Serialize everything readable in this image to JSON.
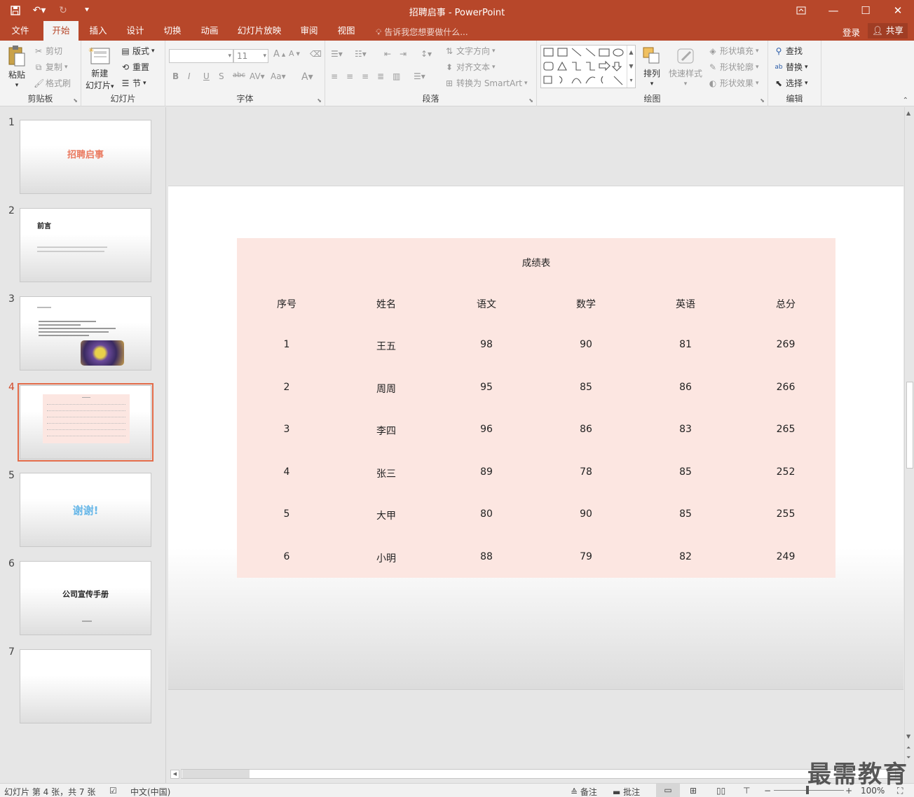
{
  "window": {
    "title": "招聘启事 - PowerPoint",
    "accent": "#b7472a"
  },
  "tabs": [
    "文件",
    "开始",
    "插入",
    "设计",
    "切换",
    "动画",
    "幻灯片放映",
    "审阅",
    "视图"
  ],
  "tell_me": "告诉我您想要做什么...",
  "account": {
    "login": "登录",
    "share": "共享"
  },
  "ribbon": {
    "clipboard": {
      "paste": "粘贴",
      "cut": "剪切",
      "copy": "复制",
      "format_painter": "格式刷",
      "label": "剪贴板"
    },
    "slides": {
      "new_slide_1": "新建",
      "new_slide_2": "幻灯片",
      "layout": "版式",
      "reset": "重置",
      "section": "节",
      "label": "幻灯片"
    },
    "font": {
      "size": "11",
      "label": "字体"
    },
    "paragraph": {
      "text_direction": "文字方向",
      "align_text": "对齐文本",
      "convert_smartart": "转换为 SmartArt",
      "label": "段落"
    },
    "drawing": {
      "arrange": "排列",
      "quick_styles": "快速样式",
      "shape_fill": "形状填充",
      "shape_outline": "形状轮廓",
      "shape_effects": "形状效果",
      "label": "绘图"
    },
    "editing": {
      "find": "查找",
      "replace": "替换",
      "select": "选择",
      "label": "编辑"
    }
  },
  "thumbnails": [
    {
      "num": "1",
      "title": "招聘启事"
    },
    {
      "num": "2",
      "title": "前言"
    },
    {
      "num": "3",
      "title": ""
    },
    {
      "num": "4",
      "title": ""
    },
    {
      "num": "5",
      "title": "谢谢!"
    },
    {
      "num": "6",
      "title": "公司宣传手册"
    },
    {
      "num": "7",
      "title": ""
    }
  ],
  "slide": {
    "table_title": "成绩表",
    "headers": [
      "序号",
      "姓名",
      "语文",
      "数学",
      "英语",
      "总分"
    ],
    "rows": [
      [
        "1",
        "王五",
        "98",
        "90",
        "81",
        "269"
      ],
      [
        "2",
        "周周",
        "95",
        "85",
        "86",
        "266"
      ],
      [
        "3",
        "李四",
        "96",
        "86",
        "83",
        "265"
      ],
      [
        "4",
        "张三",
        "89",
        "78",
        "85",
        "252"
      ],
      [
        "5",
        "大甲",
        "80",
        "90",
        "85",
        "255"
      ],
      [
        "6",
        "小明",
        "88",
        "79",
        "82",
        "249"
      ]
    ]
  },
  "status": {
    "slide_info": "幻灯片 第 4 张，共 7 张",
    "language": "中文(中国)",
    "notes": "备注",
    "comments": "批注",
    "zoom": "100%"
  },
  "watermark": "最需教育"
}
